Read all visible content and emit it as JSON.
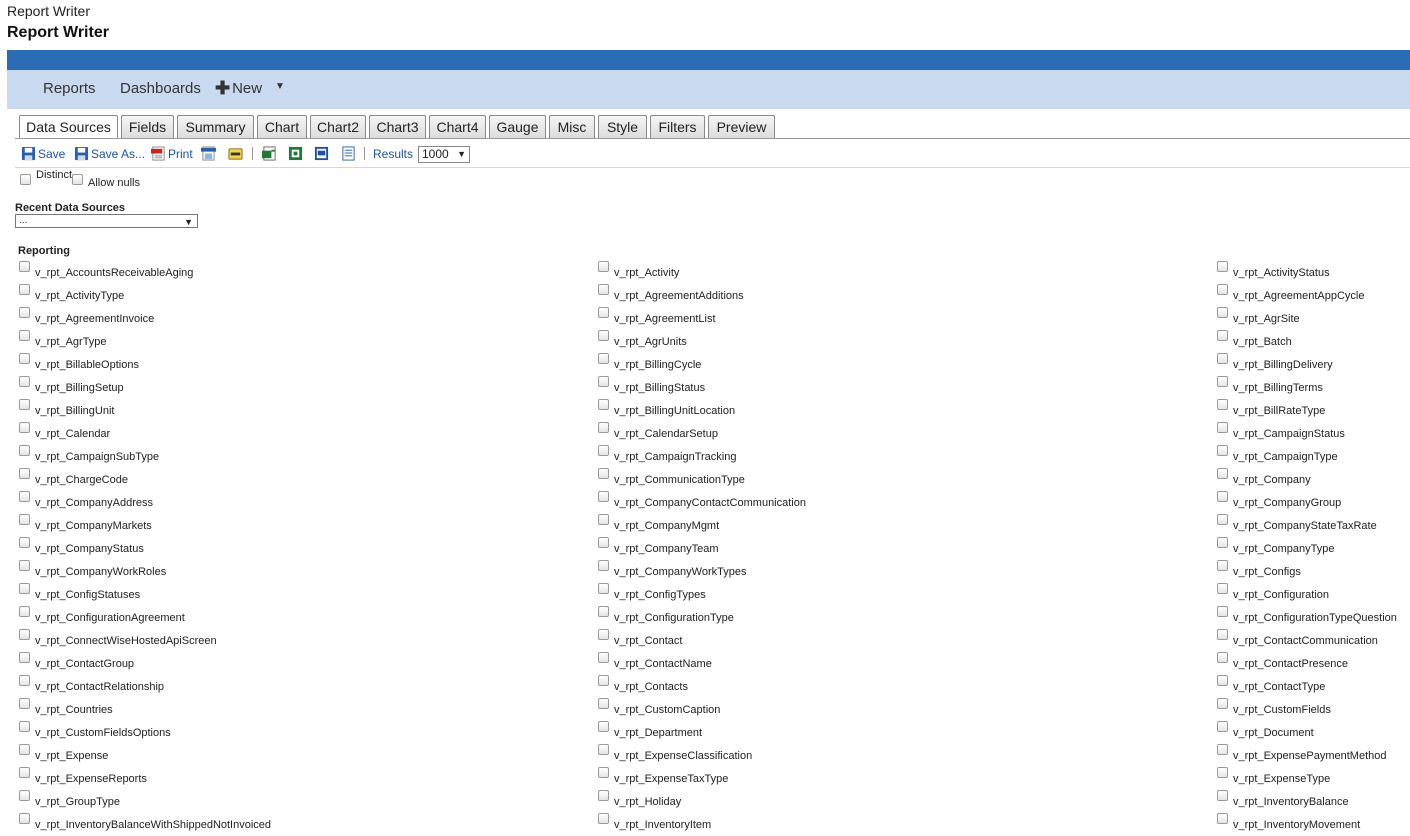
{
  "app": {
    "window_title": "Report Writer",
    "heading": "Report Writer"
  },
  "nav": {
    "reports": "Reports",
    "dashboards": "Dashboards",
    "new": "New"
  },
  "tabs": [
    "Data Sources",
    "Fields",
    "Summary",
    "Chart",
    "Chart2",
    "Chart3",
    "Chart4",
    "Gauge",
    "Misc",
    "Style",
    "Filters",
    "Preview"
  ],
  "active_tab": "Data Sources",
  "toolbar": {
    "save": "Save",
    "save_as": "Save As...",
    "print": "Print",
    "results_label": "Results",
    "results_value": "1000"
  },
  "options": {
    "distinct": "Distinct",
    "allow_nulls": "Allow nulls"
  },
  "recent": {
    "label": "Recent Data Sources",
    "value": "..."
  },
  "group": {
    "label": "Reporting"
  },
  "data_sources": [
    [
      "v_rpt_AccountsReceivableAging",
      "v_rpt_Activity",
      "v_rpt_ActivityStatus"
    ],
    [
      "v_rpt_ActivityType",
      "v_rpt_AgreementAdditions",
      "v_rpt_AgreementAppCycle"
    ],
    [
      "v_rpt_AgreementInvoice",
      "v_rpt_AgreementList",
      "v_rpt_AgrSite"
    ],
    [
      "v_rpt_AgrType",
      "v_rpt_AgrUnits",
      "v_rpt_Batch"
    ],
    [
      "v_rpt_BillableOptions",
      "v_rpt_BillingCycle",
      "v_rpt_BillingDelivery"
    ],
    [
      "v_rpt_BillingSetup",
      "v_rpt_BillingStatus",
      "v_rpt_BillingTerms"
    ],
    [
      "v_rpt_BillingUnit",
      "v_rpt_BillingUnitLocation",
      "v_rpt_BillRateType"
    ],
    [
      "v_rpt_Calendar",
      "v_rpt_CalendarSetup",
      "v_rpt_CampaignStatus"
    ],
    [
      "v_rpt_CampaignSubType",
      "v_rpt_CampaignTracking",
      "v_rpt_CampaignType"
    ],
    [
      "v_rpt_ChargeCode",
      "v_rpt_CommunicationType",
      "v_rpt_Company"
    ],
    [
      "v_rpt_CompanyAddress",
      "v_rpt_CompanyContactCommunication",
      "v_rpt_CompanyGroup"
    ],
    [
      "v_rpt_CompanyMarkets",
      "v_rpt_CompanyMgmt",
      "v_rpt_CompanyStateTaxRate"
    ],
    [
      "v_rpt_CompanyStatus",
      "v_rpt_CompanyTeam",
      "v_rpt_CompanyType"
    ],
    [
      "v_rpt_CompanyWorkRoles",
      "v_rpt_CompanyWorkTypes",
      "v_rpt_Configs"
    ],
    [
      "v_rpt_ConfigStatuses",
      "v_rpt_ConfigTypes",
      "v_rpt_Configuration"
    ],
    [
      "v_rpt_ConfigurationAgreement",
      "v_rpt_ConfigurationType",
      "v_rpt_ConfigurationTypeQuestion"
    ],
    [
      "v_rpt_ConnectWiseHostedApiScreen",
      "v_rpt_Contact",
      "v_rpt_ContactCommunication"
    ],
    [
      "v_rpt_ContactGroup",
      "v_rpt_ContactName",
      "v_rpt_ContactPresence"
    ],
    [
      "v_rpt_ContactRelationship",
      "v_rpt_Contacts",
      "v_rpt_ContactType"
    ],
    [
      "v_rpt_Countries",
      "v_rpt_CustomCaption",
      "v_rpt_CustomFields"
    ],
    [
      "v_rpt_CustomFieldsOptions",
      "v_rpt_Department",
      "v_rpt_Document"
    ],
    [
      "v_rpt_Expense",
      "v_rpt_ExpenseClassification",
      "v_rpt_ExpensePaymentMethod"
    ],
    [
      "v_rpt_ExpenseReports",
      "v_rpt_ExpenseTaxType",
      "v_rpt_ExpenseType"
    ],
    [
      "v_rpt_GroupType",
      "v_rpt_Holiday",
      "v_rpt_InventoryBalance"
    ],
    [
      "v_rpt_InventoryBalanceWithShippedNotInvoiced",
      "v_rpt_InventoryItem",
      "v_rpt_InventoryMovement"
    ]
  ]
}
